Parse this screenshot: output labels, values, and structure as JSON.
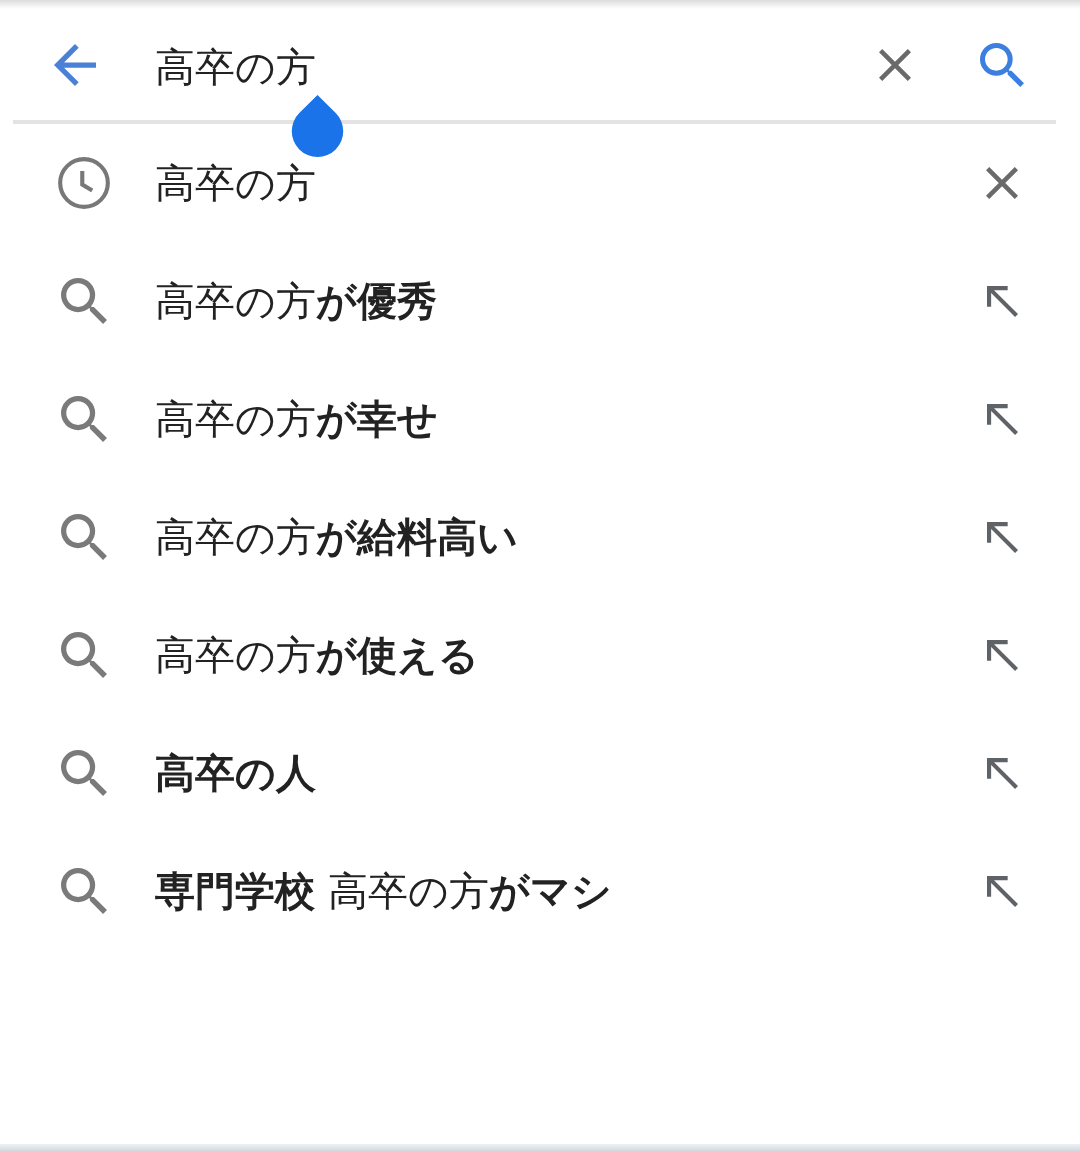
{
  "search_bar": {
    "value": "高卒の方"
  },
  "suggestions": [
    {
      "kind": "history",
      "text": "高卒の方",
      "bold": false
    },
    {
      "kind": "suggestion",
      "text": "高卒の方**が優秀**",
      "bold": false
    },
    {
      "kind": "suggestion",
      "text": "高卒の方**が幸せ**",
      "bold": false
    },
    {
      "kind": "suggestion",
      "text": "高卒の方**が給料高い**",
      "bold": false
    },
    {
      "kind": "suggestion",
      "text": "高卒の方**が使える**",
      "bold": false
    },
    {
      "kind": "suggestion",
      "text": "高卒の人",
      "bold": true
    },
    {
      "kind": "suggestion",
      "text": "**専門学校** 高卒の方**がマシ**",
      "bold": false
    }
  ]
}
